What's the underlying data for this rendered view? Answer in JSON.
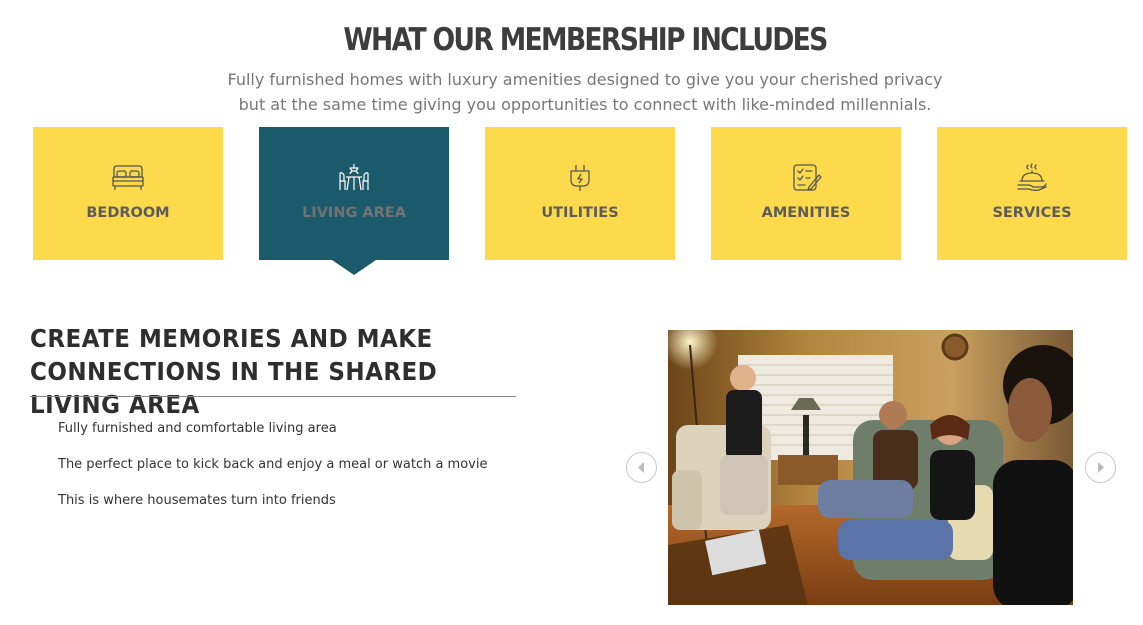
{
  "header": {
    "title": "WHAT OUR MEMBERSHIP INCLUDES",
    "subtitle_line1": "Fully furnished homes with luxury amenities designed to give you your cherished privacy",
    "subtitle_line2": "but at the same time giving you opportunities to connect with like-minded millennials."
  },
  "tabs": [
    {
      "label": "BEDROOM",
      "icon": "bed-icon",
      "active": false
    },
    {
      "label": "LIVING AREA",
      "icon": "dining-table-icon",
      "active": true
    },
    {
      "label": "UTILITIES",
      "icon": "power-plug-icon",
      "active": false
    },
    {
      "label": "AMENITIES",
      "icon": "checklist-icon",
      "active": false
    },
    {
      "label": "SERVICES",
      "icon": "serving-cloche-icon",
      "active": false
    }
  ],
  "content": {
    "title_line1": "CREATE MEMORIES AND MAKE",
    "title_line2": "CONNECTIONS IN THE SHARED LIVING AREA",
    "features": [
      "Fully furnished and comfortable living area",
      "The perfect place to kick back and enjoy a meal or watch a movie",
      "This is where housemates turn into friends"
    ]
  },
  "carousel": {
    "prev_icon": "chevron-left-icon",
    "next_icon": "chevron-right-icon"
  },
  "colors": {
    "tab_background": "#fdda4b",
    "tab_active_background": "#1b5a6a",
    "heading_text": "#3d3d3d",
    "subtitle_text": "#777777"
  }
}
